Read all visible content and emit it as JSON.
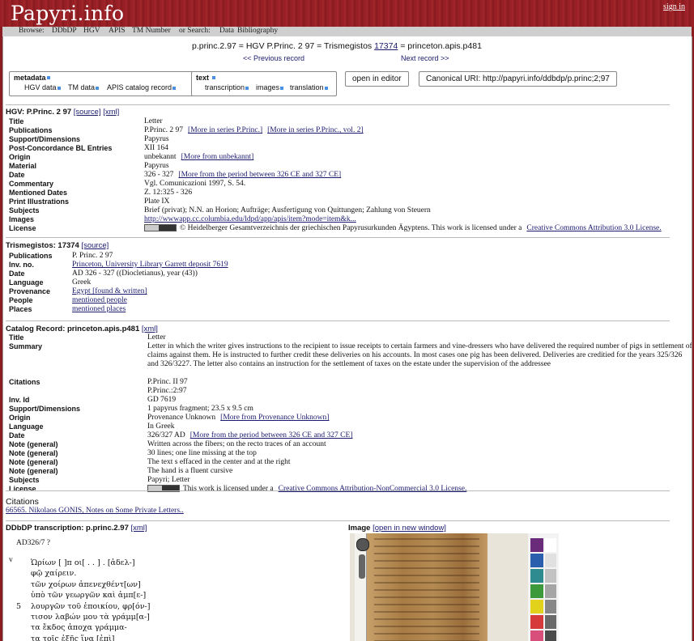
{
  "site": {
    "logo": "Papyri.info",
    "signin": "sign in"
  },
  "nav": {
    "browse": "Browse:",
    "ddbdp": "DDbDP",
    "hgv": "HGV",
    "apis": "APIS",
    "tm": "TM Number",
    "search": "or Search:",
    "data": "Data",
    "bibliography": "Bibliography"
  },
  "header": {
    "ids": "p.princ.2.97 = HGV P.Princ. 2 97 = Trismegistos",
    "tm_link": "17374",
    "ids_tail": "= princeton.apis.p481",
    "prev": "<< Previous record",
    "next": "Next record >>"
  },
  "toolbar": {
    "metadata": "metadata",
    "hgv_data": "HGV data",
    "tm_data": "TM data",
    "apis_catalog": "APIS catalog record",
    "text": "text",
    "transcription": "transcription",
    "images": "images",
    "translation": "translation",
    "open_editor": "open in editor",
    "canonical_label": "Canonical URI:",
    "canonical_url": "http://papyri.info/ddbdp/p.princ;2;97"
  },
  "hgv": {
    "heading": "HGV: P.Princ. 2 97",
    "source": "[source]",
    "xml": "[xml]",
    "rows": [
      {
        "label": "Title",
        "value": "Letter",
        "links": []
      },
      {
        "label": "Publications",
        "value": "P.Princ. 2 97",
        "links": [
          "[More in series P.Princ.]",
          "[More in series P.Princ., vol. 2]"
        ]
      },
      {
        "label": "Support/Dimensions",
        "value": "Papyrus",
        "links": []
      },
      {
        "label": "Post-Concordance BL Entries",
        "value": "XII 164",
        "links": []
      },
      {
        "label": "Origin",
        "value": "unbekannt",
        "links": [
          "[More from unbekannt]"
        ]
      },
      {
        "label": "Material",
        "value": "Papyrus",
        "links": []
      },
      {
        "label": "Date",
        "value": "326 - 327",
        "links": [
          "[More from the period between 326 CE and 327 CE]"
        ]
      },
      {
        "label": "Commentary",
        "value": "Vgl. Comunicazioni 1997, S. 54.",
        "links": []
      },
      {
        "label": "Mentioned Dates",
        "value": "Z. 12:325 - 326",
        "links": []
      },
      {
        "label": "Print Illustrations",
        "value": "Plate IX",
        "links": []
      },
      {
        "label": "Subjects",
        "value": "Brief (privat); N.N. an Horion; Aufträge; Ausfertigung von Quittungen; Zahlung von Steuern",
        "links": []
      },
      {
        "label": "Images",
        "value": "",
        "links": [
          "http://wwwapp.cc.columbia.edu/ldpd/app/apis/item?mode=item&k..."
        ]
      },
      {
        "label": "License",
        "value": "© Heidelberger Gesamtverzeichnis der griechischen Papyrusurkunden Ägyptens. This work is licensed under a",
        "links": [
          "Creative Commons Attribution 3.0 License."
        ]
      }
    ]
  },
  "tm": {
    "heading": "Trismegistos: 17374",
    "source": "[source]",
    "rows": [
      {
        "label": "Publications",
        "value": "P. Princ. 2 97",
        "links": []
      },
      {
        "label": "Inv. no.",
        "value": "",
        "links": [
          "Princeton, University Library Garrett deposit 7619"
        ]
      },
      {
        "label": "Date",
        "value": "AD 326 - 327 ((Diocletianus), year (43))",
        "links": []
      },
      {
        "label": "Language",
        "value": "Greek",
        "links": []
      },
      {
        "label": "Provenance",
        "value": "",
        "links": [
          "Egypt [found & written]"
        ]
      },
      {
        "label": "People",
        "value": "",
        "links": [
          "mentioned people"
        ]
      },
      {
        "label": "Places",
        "value": "",
        "links": [
          "mentioned places"
        ]
      }
    ]
  },
  "apis": {
    "heading": "Catalog Record: princeton.apis.p481",
    "xml": "[xml]",
    "rows": [
      {
        "label": "Title",
        "value": "Letter",
        "links": []
      },
      {
        "label": "Summary",
        "value": "Letter in which the writer gives instructions to the recipient to issue receipts to certain farmers and vine-dressers who have delivered the required number of pigs in settlement of claims against them. He is instructed to further credit these deliveries on his accounts. In most cases one pig has been delivered. Deliveries are creditied for the years 325/326 and 326/3227. The letter also contains an instruction for the settlement of taxes on the estate under the supervision of the addressee",
        "links": []
      },
      {
        "label": "Citations",
        "value": "P.Princ. II 97",
        "links": []
      },
      {
        "label": "",
        "value": "P.Princ.:2:97",
        "links": []
      },
      {
        "label": "Inv. Id",
        "value": "GD 7619",
        "links": []
      },
      {
        "label": "Support/Dimensions",
        "value": "1 papyrus fragment; 23.5 x 9.5 cm",
        "links": []
      },
      {
        "label": "Origin",
        "value": "Provenance Unknown",
        "links": [
          "[More from Provenance Unknown]"
        ]
      },
      {
        "label": "Language",
        "value": "In Greek",
        "links": []
      },
      {
        "label": "Date",
        "value": "326/327 AD",
        "links": [
          "[More from the period between 326 CE and 327 CE]"
        ]
      },
      {
        "label": "Note (general)",
        "value": "Written across the fibers; on the recto traces of an account",
        "links": []
      },
      {
        "label": "Note (general)",
        "value": "30 lines; one line missing at the top",
        "links": []
      },
      {
        "label": "Note (general)",
        "value": "The text s effaced in the center and at the right",
        "links": []
      },
      {
        "label": "Note (general)",
        "value": "The hand is a fluent cursive",
        "links": []
      },
      {
        "label": "Subjects",
        "value": "Papyri; Letter",
        "links": []
      },
      {
        "label": "License",
        "value": "This work is licensed under a",
        "links": [
          "Creative Commons Attribution-NonCommercial 3.0 License."
        ]
      }
    ]
  },
  "citations": {
    "heading": "Citations",
    "item": "66565. Nikolaos GONIS, Notes on Some Private Letters.."
  },
  "ddbdp": {
    "heading": "DDbDP transcription: p.princ.2.97",
    "xml": "[xml]",
    "date": "AD326/7 ?",
    "side": "v",
    "lines": [
      {
        "n": "",
        "t": "Ὡρίων [ ]π οι[ . . ] . [ἀδελ-]"
      },
      {
        "n": "",
        "t": "φῷ χαίρειν."
      },
      {
        "n": "",
        "t": "τῶν χοίρων ἀπενεχθέντ[ων]"
      },
      {
        "n": "",
        "t": "ὑπὸ τῶν γεωργῶν καὶ ἀμπ[ε-]"
      },
      {
        "n": "5",
        "t": "λουργῶν τοῦ ἐποικίου, φρ[όν-]"
      },
      {
        "n": "",
        "t": "τισον λαβών μου τὰ γράμμ[α-]"
      },
      {
        "n": "",
        "t": "τα ἔκδος ἀποχα γράμμα-"
      },
      {
        "n": "",
        "t": "τα τοῖς ἑξῆς ἵνα [ἐπὶ]"
      }
    ]
  },
  "image": {
    "heading": "Image",
    "open": "[open in new window]",
    "swatches": [
      "#6a2c7a",
      "#2b5fae",
      "#2e8b8f",
      "#3c9a3a",
      "#e3d21c",
      "#d63a3a",
      "#d94f7c"
    ]
  }
}
